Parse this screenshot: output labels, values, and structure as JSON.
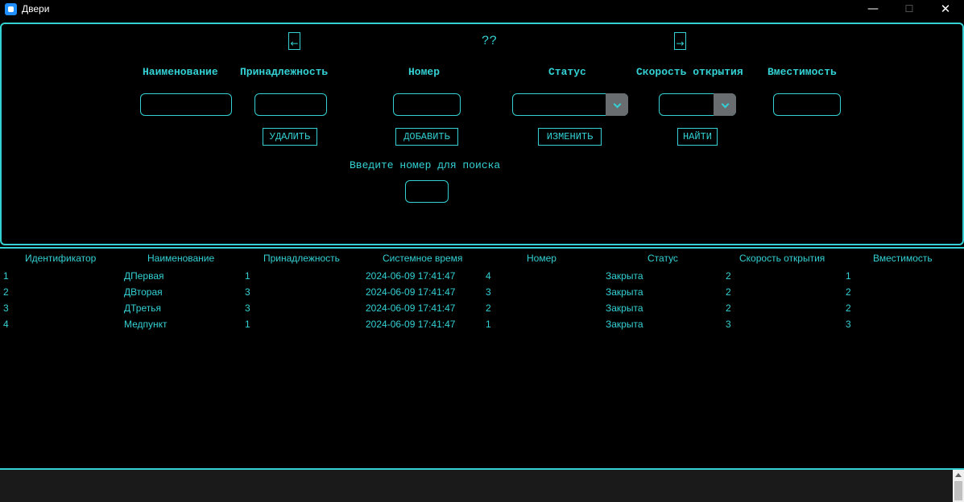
{
  "window": {
    "title": "Двери",
    "min_glyph": "—",
    "max_glyph": "☐",
    "close_glyph": "✕"
  },
  "nav": {
    "prev": "←",
    "page": "??",
    "next": "→"
  },
  "form": {
    "labels": {
      "name": "Наименование",
      "belonging": "Принадлежность",
      "number": "Номер",
      "status": "Статус",
      "speed": "Скорость открытия",
      "capacity": "Вместимость"
    },
    "values": {
      "name": "",
      "belonging": "",
      "number": "",
      "status": "",
      "speed": "",
      "capacity": ""
    }
  },
  "actions": {
    "delete": "УДАЛИТЬ",
    "add": "ДОБАВИТЬ",
    "edit": "ИЗМЕНИТЬ",
    "find": "НАЙТИ"
  },
  "search": {
    "label": "Введите номер для поиска",
    "value": ""
  },
  "table": {
    "headers": [
      "Идентификатор",
      "Наименование",
      "Принадлежность",
      "Системное время",
      "Номер",
      "Статус",
      "Скорость открытия",
      "Вместимость"
    ],
    "rows": [
      [
        "1",
        "ДПервая",
        "1",
        "2024-06-09 17:41:47",
        "4",
        "Закрыта",
        "2",
        "1"
      ],
      [
        "2",
        "ДВторая",
        "3",
        "2024-06-09 17:41:47",
        "3",
        "Закрыта",
        "2",
        "2"
      ],
      [
        "3",
        "ДТретья",
        "3",
        "2024-06-09 17:41:47",
        "2",
        "Закрыта",
        "2",
        "2"
      ],
      [
        "4",
        "Медпункт",
        "1",
        "2024-06-09 17:41:47",
        "1",
        "Закрыта",
        "3",
        "3"
      ]
    ]
  },
  "colors": {
    "accent": "#33d1d4",
    "background": "#000000",
    "combo_arrow": "#6a6d70"
  }
}
